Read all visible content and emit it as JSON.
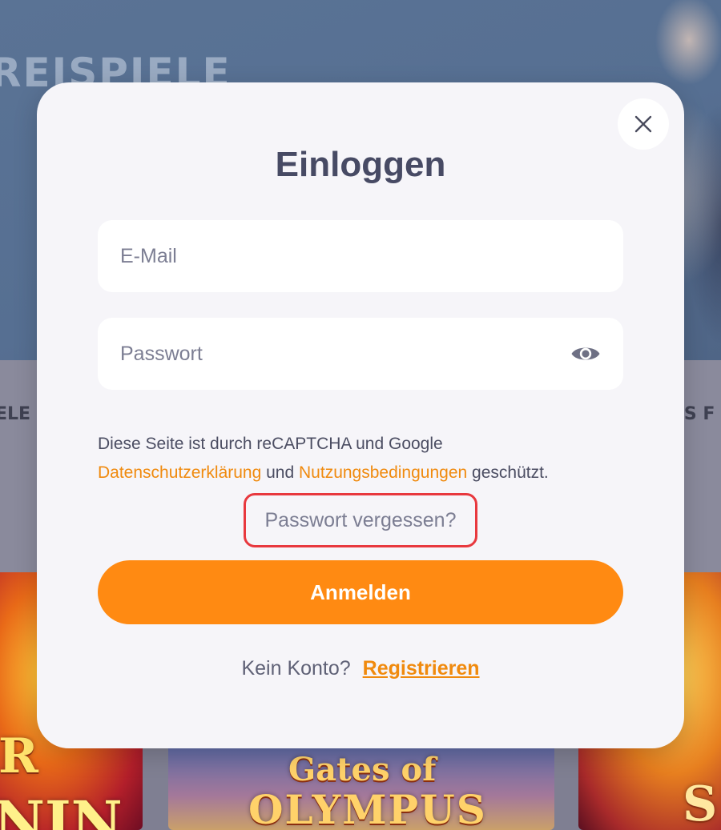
{
  "background": {
    "hero_title": "REISPIELE",
    "side_label_left": "ELE",
    "side_label_right": "US F",
    "tiles": {
      "left_top": "R",
      "left_bottom": "NIN",
      "mid_line1": "Gates of",
      "mid_line2": "OLYMPUS",
      "right": "S"
    }
  },
  "modal": {
    "title": "Einloggen",
    "email_placeholder": "E-Mail",
    "password_placeholder": "Passwort",
    "recaptcha": {
      "text_before": "Diese Seite ist durch reCAPTCHA und Google",
      "privacy_link": "Datenschutzerklärung",
      "and": "und",
      "terms_link": "Nutzungsbedingungen",
      "text_after": "geschützt."
    },
    "forgot_password": "Passwort vergessen?",
    "submit_label": "Anmelden",
    "no_account_text": "Kein Konto?",
    "register_link": "Registrieren"
  },
  "icons": {
    "close": "close-icon",
    "password_visibility": "eye-icon"
  },
  "colors": {
    "accent": "#ff8a12",
    "link": "#f08a0e",
    "title": "#474a64",
    "modal_bg": "#f6f5f9",
    "highlight_border": "#e8383e"
  }
}
